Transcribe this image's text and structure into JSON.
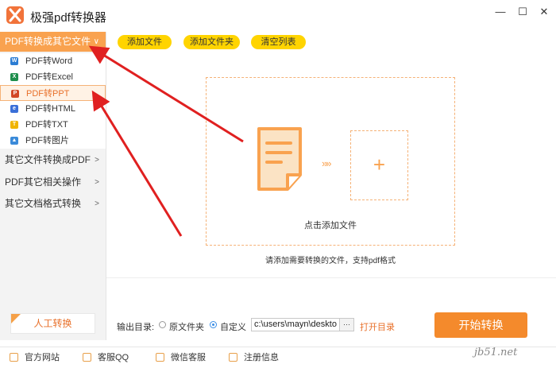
{
  "app": {
    "title": "极强pdf转换器",
    "logo_icon": "app-logo-icon"
  },
  "window_controls": [
    {
      "name": "minimize-button",
      "glyph": "—"
    },
    {
      "name": "maximize-button",
      "glyph": "☐"
    },
    {
      "name": "close-button",
      "glyph": "✕"
    }
  ],
  "sidebar": {
    "active_category": {
      "label": "PDF转换成其它文件",
      "chevron": "∨"
    },
    "sub_items": [
      {
        "label": "PDF转Word",
        "icon": "word-icon",
        "color": "#2b7cd3",
        "letter": "W"
      },
      {
        "label": "PDF转Excel",
        "icon": "excel-icon",
        "color": "#1e8e4c",
        "letter": "X"
      },
      {
        "label": "PDF转PPT",
        "icon": "ppt-icon",
        "color": "#d24726",
        "letter": "P"
      },
      {
        "label": "PDF转HTML",
        "icon": "html-icon",
        "color": "#3a6fd8",
        "letter": "e"
      },
      {
        "label": "PDF转TXT",
        "icon": "txt-icon",
        "color": "#f0b400",
        "letter": "T"
      },
      {
        "label": "PDF转图片",
        "icon": "image-icon",
        "color": "#3a8ad9",
        "letter": "▲"
      }
    ],
    "categories": [
      {
        "label": "其它文件转换成PDF",
        "chevron": ">"
      },
      {
        "label": "PDF其它相关操作",
        "chevron": ">"
      },
      {
        "label": "其它文档格式转换",
        "chevron": ">"
      }
    ],
    "manual_button": "人工转换"
  },
  "toolbar": {
    "add_file": "添加文件",
    "add_folder": "添加文件夹",
    "clear_list": "清空列表"
  },
  "dropzone": {
    "label": "点击添加文件",
    "arrows": "»»",
    "plus": "+",
    "hint": "请添加需要转换的文件，支持pdf格式"
  },
  "output": {
    "label": "输出目录:",
    "option_original": "原文件夹",
    "option_custom": "自定义",
    "path": "c:\\users\\mayn\\deskto",
    "browse": "···",
    "open_dir": "打开目录",
    "selected": "custom"
  },
  "start_button": "开始转换",
  "footer": [
    {
      "label": "官方网站",
      "icon": "website-icon"
    },
    {
      "label": "客服QQ",
      "icon": "qq-icon"
    },
    {
      "label": "微信客服",
      "icon": "wechat-icon"
    },
    {
      "label": "注册信息",
      "icon": "register-icon"
    }
  ],
  "watermark": "jb51.net",
  "colors": {
    "accent": "#f9a24f",
    "button_yellow": "#ffd400",
    "start": "#f48a2c",
    "annotation_red": "#e02020"
  }
}
